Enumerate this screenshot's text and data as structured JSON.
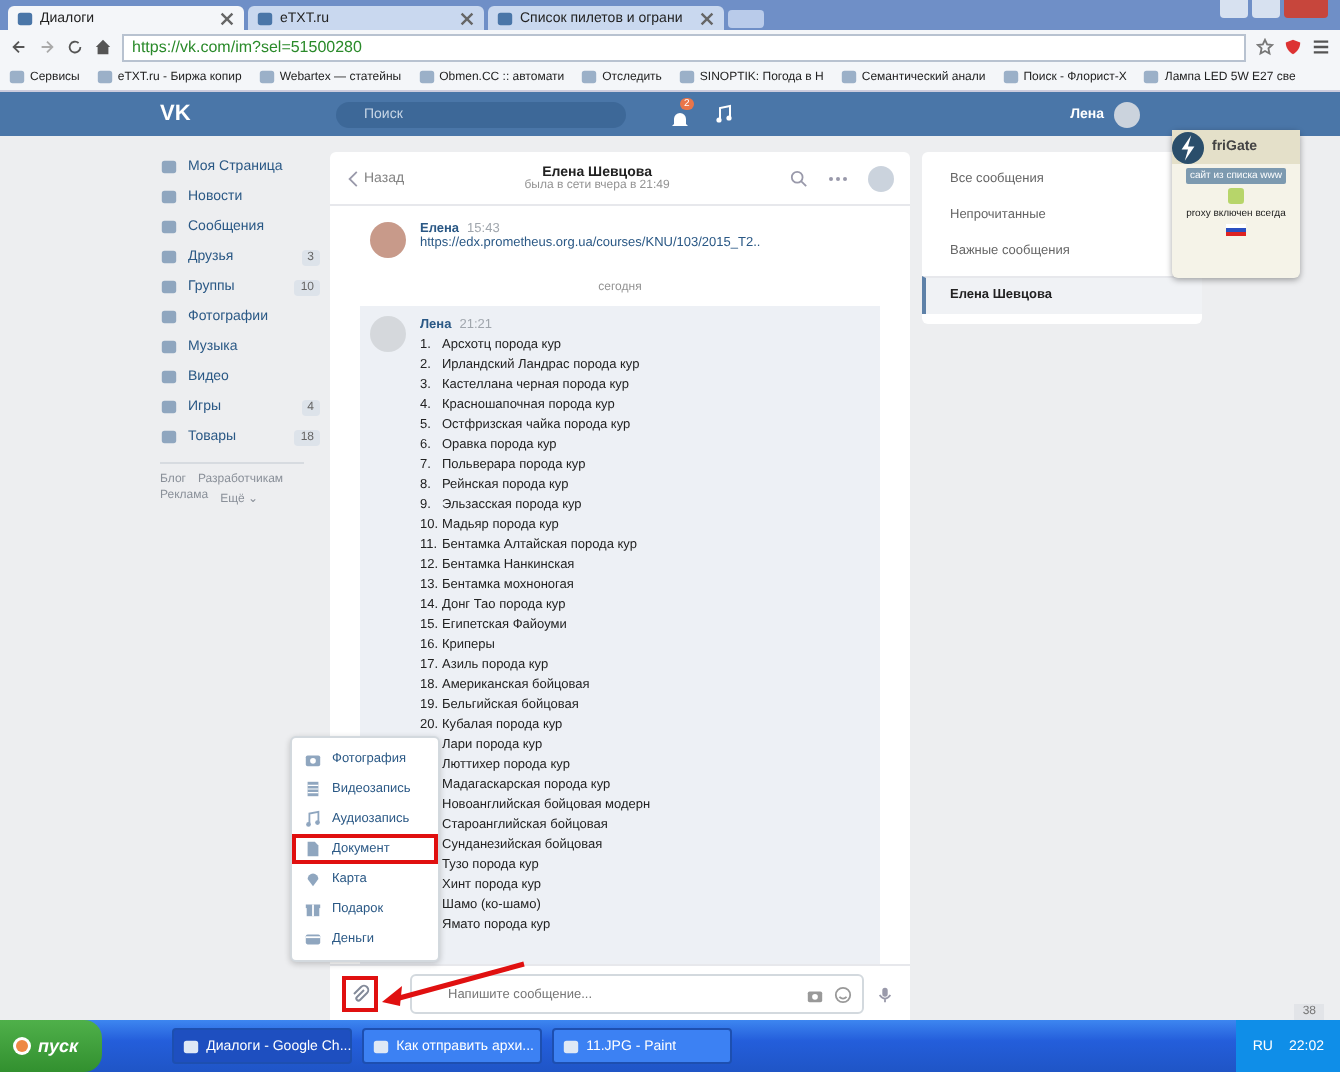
{
  "browser": {
    "tabs": [
      {
        "label": "Диалоги",
        "selected": true
      },
      {
        "label": "eTXT.ru",
        "selected": false
      },
      {
        "label": "Список пилетов и ограни",
        "selected": false
      }
    ],
    "url": "https://vk.com/im?sel=51500280",
    "bookmarks": [
      "Сервисы",
      "eTXT.ru - Биржа копир",
      "Webartex — статейны",
      "Obmen.CC :: автомати",
      "Отследить",
      "SINOPTIK: Погода в Н",
      "Семантический анали",
      "Поиск - Флорист-Х",
      "Лампа LED 5W E27 све"
    ]
  },
  "header": {
    "logo": "VK",
    "search": {
      "placeholder": "Поиск"
    },
    "notifications": "2",
    "user": "Лена"
  },
  "sidebar": {
    "items": [
      {
        "label": "Моя Страница"
      },
      {
        "label": "Новости"
      },
      {
        "label": "Сообщения"
      },
      {
        "label": "Друзья",
        "count": "3"
      },
      {
        "label": "Группы",
        "count": "10"
      },
      {
        "label": "Фотографии"
      },
      {
        "label": "Музыка"
      },
      {
        "label": "Видео"
      },
      {
        "label": "Игры",
        "count": "4"
      },
      {
        "label": "Товары",
        "count": "18"
      }
    ],
    "footer": [
      "Блог",
      "Разработчикам",
      "Реклама",
      "Ещё ⌄"
    ]
  },
  "chat": {
    "back": "Назад",
    "name": "Елена Шевцова",
    "status": "была в сети вчера в 21:49",
    "messages": [
      {
        "author": "Елена",
        "time": "15:43",
        "lines": [
          {
            "text": "https://edx.prometheus.org.ua/courses/KNU/103/2015_T2.."
          }
        ]
      }
    ],
    "date_divider": "сегодня",
    "highlighted_message": {
      "author": "Лена",
      "time": "21:21",
      "lines": [
        {
          "number": "1.",
          "text": "Арсхотц порода кур"
        },
        {
          "number": "2.",
          "text": "Ирландский Ландрас порода кур"
        },
        {
          "number": "3.",
          "text": "Кастеллана черная порода кур"
        },
        {
          "number": "4.",
          "text": "Красношапочная порода кур"
        },
        {
          "number": "5.",
          "text": "Остфризская чайка порода кур"
        },
        {
          "number": "6.",
          "text": "Оравка порода кур"
        },
        {
          "number": "7.",
          "text": "Польверара порода кур"
        },
        {
          "number": "8.",
          "text": "Рейнская порода кур"
        },
        {
          "number": "9.",
          "text": "Эльзасская порода кур"
        },
        {
          "number": "10.",
          "text": "Мадьяр порода кур"
        },
        {
          "number": "11.",
          "text": "Бентамка Алтайская порода кур"
        },
        {
          "number": "12.",
          "text": "Бентамка Нанкинская"
        },
        {
          "number": "13.",
          "text": "Бентамка мохноногая"
        },
        {
          "number": "14.",
          "text": "Донг Тао порода кур"
        },
        {
          "number": "15.",
          "text": "Египетская Файоуми"
        },
        {
          "number": "16.",
          "text": "Криперы"
        },
        {
          "number": "17.",
          "text": "Азиль порода кур"
        },
        {
          "number": "18.",
          "text": "Американская бойцовая"
        },
        {
          "number": "19.",
          "text": "Бельгийская бойцовая"
        },
        {
          "number": "20.",
          "text": "Кубалая порода кур"
        },
        {
          "text": "Лари порода кур"
        },
        {
          "text": "Люттихер порода кур"
        },
        {
          "text": "Мадагаскарская порода кур"
        },
        {
          "text": "Новоанглийская бойцовая модерн"
        },
        {
          "text": "Староанглийская бойцовая"
        },
        {
          "text": "Сунданезийская бойцовая"
        },
        {
          "text": "Тузо порода кур"
        },
        {
          "text": "Хинт порода кур"
        },
        {
          "text": "Шамо (ко-шамо)"
        },
        {
          "text": "Ямато порода кур"
        }
      ]
    },
    "attach_menu": [
      {
        "kind": "photo",
        "label": "Фотография",
        "annotated": false
      },
      {
        "kind": "video",
        "label": "Видеозапись",
        "annotated": false
      },
      {
        "kind": "audio",
        "label": "Аудиозапись",
        "annotated": false
      },
      {
        "kind": "doc",
        "label": "Документ",
        "annotated": true
      },
      {
        "kind": "map",
        "label": "Карта",
        "annotated": false
      },
      {
        "kind": "gift",
        "label": "Подарок",
        "annotated": false
      },
      {
        "kind": "money",
        "label": "Деньги",
        "annotated": false
      }
    ],
    "composer": {
      "placeholder": "Напишите сообщение...",
      "attach_annotated": true
    }
  },
  "filters": [
    {
      "label": "Все сообщения",
      "selected": false
    },
    {
      "label": "Непрочитанные",
      "selected": false
    },
    {
      "label": "Важные сообщения",
      "selected": false
    },
    {
      "label": "Елена Шевцова",
      "selected": true
    }
  ],
  "frigate": {
    "title": "friGate",
    "badge": "сайт из списка www",
    "note": "proxy включен всегда"
  },
  "online_count": "38",
  "taskbar": {
    "start": "пуск",
    "tasks": [
      "Диалоги - Google Ch...",
      "Как отправить архи...",
      "11.JPG - Paint"
    ],
    "lang": "RU",
    "clock": "22:02"
  }
}
